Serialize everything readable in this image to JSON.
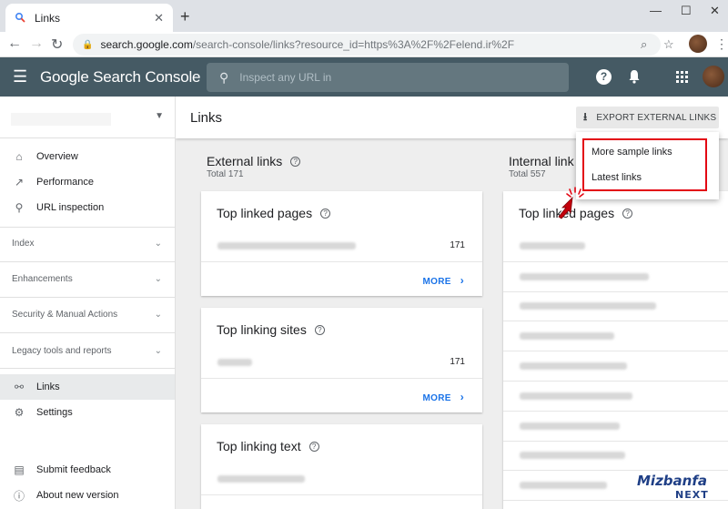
{
  "browser": {
    "tab_title": "Links",
    "url_host": "search.google.com",
    "url_rest": "/search-console/links?resource_id=https%3A%2F%2Felend.ir%2F"
  },
  "header": {
    "product_name": "Google Search Console",
    "inspect_placeholder": "Inspect any URL in"
  },
  "sidebar": {
    "items": [
      {
        "label": "Overview",
        "icon": "home-icon"
      },
      {
        "label": "Performance",
        "icon": "trending-up-icon"
      },
      {
        "label": "URL inspection",
        "icon": "search-icon"
      }
    ],
    "sections": [
      "Index",
      "Enhancements",
      "Security & Manual Actions",
      "Legacy tools and reports"
    ],
    "links_label": "Links",
    "settings_label": "Settings",
    "feedback_label": "Submit feedback",
    "about_label": "About new version"
  },
  "main": {
    "page_title": "Links",
    "export_label": "EXPORT EXTERNAL LINKS",
    "external": {
      "title": "External links",
      "total": "Total 171",
      "top_linked_pages": {
        "title": "Top linked pages",
        "count": "171",
        "more": "MORE"
      },
      "top_linking_sites": {
        "title": "Top linking sites",
        "count": "171",
        "more": "MORE"
      },
      "top_linking_text": {
        "title": "Top linking text"
      }
    },
    "internal": {
      "title": "Internal link",
      "total": "Total 557",
      "top_linked_pages": {
        "title": "Top linked pages"
      }
    }
  },
  "menu": {
    "items": [
      "More sample links",
      "Latest links"
    ]
  },
  "watermark": {
    "main": "Mizbanfa",
    "sub": "NEXT"
  },
  "colors": {
    "header": "#455a64",
    "accent": "#1a73e8",
    "highlight": "#e30613"
  }
}
